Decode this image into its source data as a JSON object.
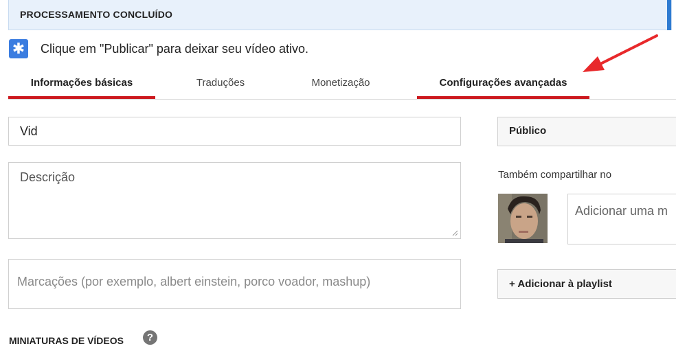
{
  "banner": {
    "title": "PROCESSAMENTO CONCLUÍDO",
    "accent_color": "#2e7bd1"
  },
  "notice": {
    "icon": "asterisk-icon",
    "text": "Clique em \"Publicar\" para deixar seu vídeo ativo."
  },
  "tabs": [
    {
      "label": "Informações básicas",
      "active": true
    },
    {
      "label": "Traduções",
      "active": false
    },
    {
      "label": "Monetização",
      "active": false
    },
    {
      "label": "Configurações avançadas",
      "active": false,
      "highlighted": true
    }
  ],
  "annotation": {
    "icon": "red-arrow-icon",
    "color": "#e8292b"
  },
  "form": {
    "title_value": "Vid",
    "description_placeholder": "Descrição",
    "tags_placeholder": "Marcações (por exemplo, albert einstein, porco voador, mashup)"
  },
  "sidebar": {
    "privacy_value": "Público",
    "share_label": "Também compartilhar no",
    "comment_placeholder": "Adicionar uma m",
    "playlist_button": "+ Adicionar à playlist"
  },
  "thumbnails": {
    "title": "MINIATURAS DE VÍDEOS",
    "help_icon": "question-icon"
  },
  "colors": {
    "tab_underline": "#cc181e",
    "notice_icon_bg": "#3b7de0"
  }
}
